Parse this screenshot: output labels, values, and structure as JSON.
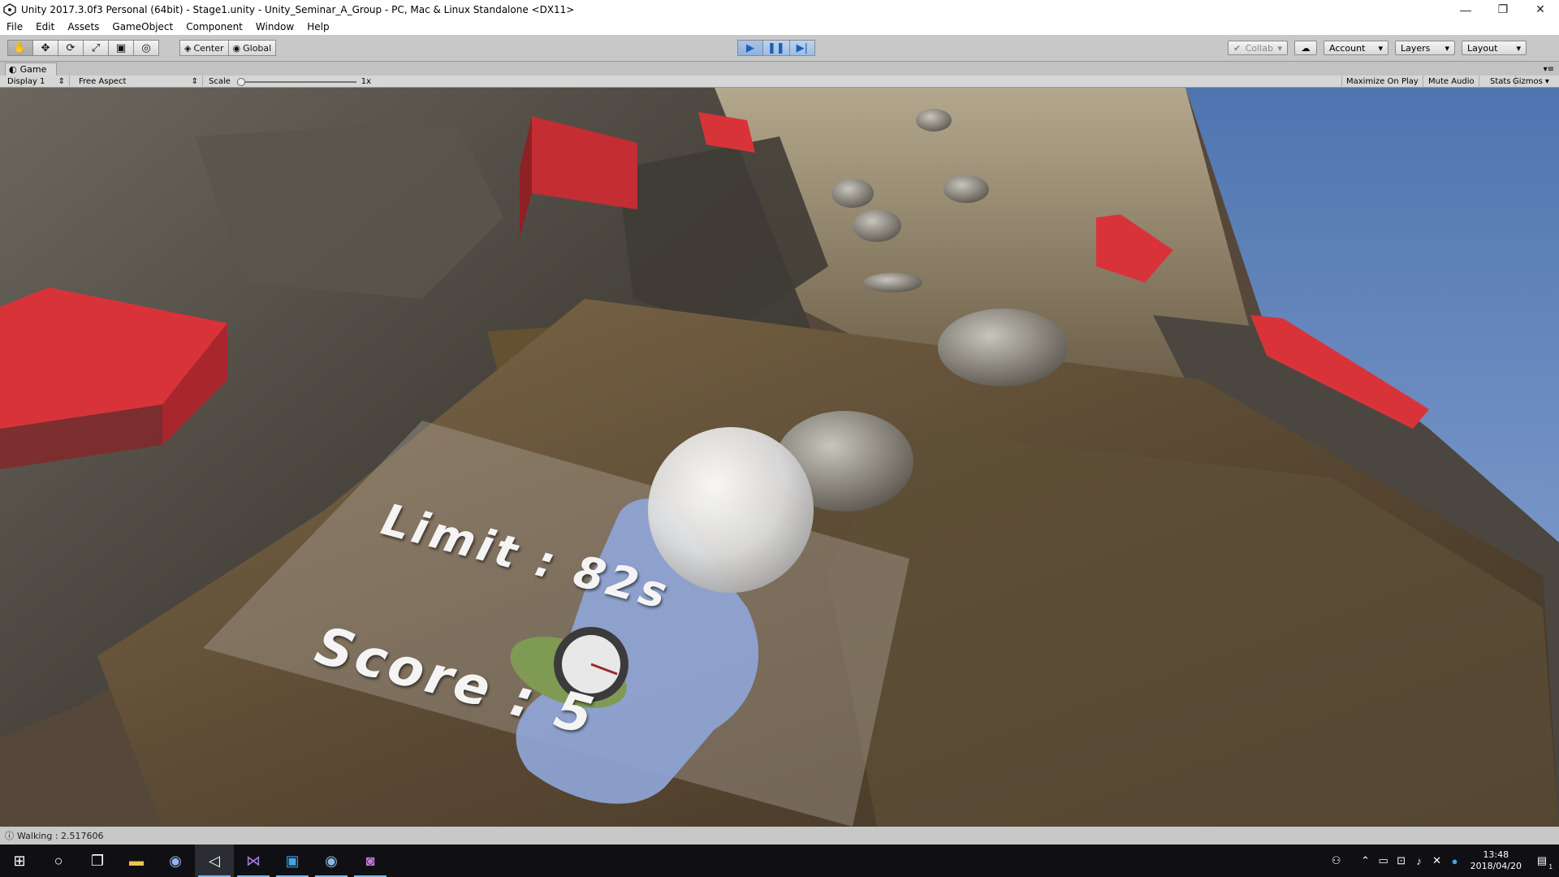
{
  "window": {
    "title": "Unity 2017.3.0f3 Personal (64bit) - Stage1.unity - Unity_Seminar_A_Group - PC, Mac & Linux Standalone <DX11>",
    "controls": [
      "—",
      "❐",
      "✕"
    ]
  },
  "menu": [
    "File",
    "Edit",
    "Assets",
    "GameObject",
    "Component",
    "Window",
    "Help"
  ],
  "toolbar": {
    "tools": [
      "hand-icon",
      "move-icon",
      "rotate-icon",
      "scale-icon",
      "rect-icon",
      "transform-icon"
    ],
    "pivot": "Center",
    "space": "Global",
    "collab": "Collab",
    "account": "Account",
    "layers": "Layers",
    "layout": "Layout"
  },
  "game_panel": {
    "tab": "Game",
    "display": "Display 1",
    "aspect": "Free Aspect",
    "scale_label": "Scale",
    "scale_value": "1x",
    "scale_level": 0.0,
    "options": [
      "Maximize On Play",
      "Mute Audio",
      "Stats",
      "Gizmos"
    ]
  },
  "hud": {
    "limit": "Limit : 82s",
    "score": "Score : 5"
  },
  "status": "Walking : 2.517606",
  "taskbar": {
    "time": "13:48",
    "date": "2018/04/20",
    "notifications": "1"
  },
  "colors": {
    "play_active": "#8fb1dd",
    "red_cube": "#d9333a",
    "sky": "#5a7fb8"
  }
}
